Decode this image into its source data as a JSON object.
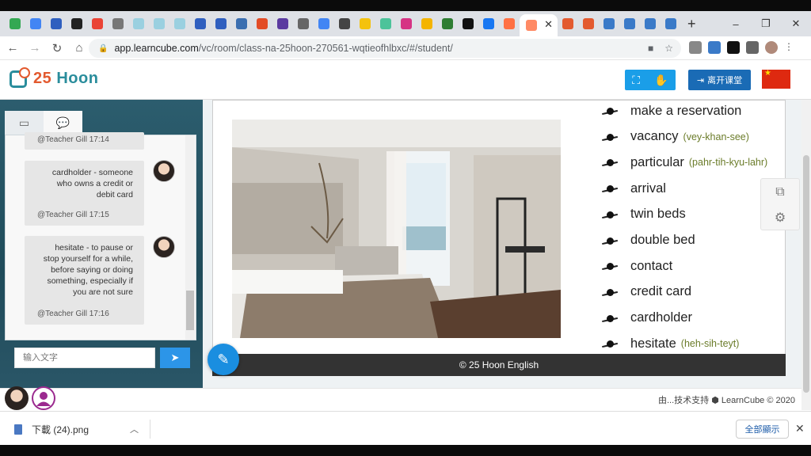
{
  "browser": {
    "url_host": "app.learncube.com",
    "url_path": "/vc/room/class-na-25hoon-270561-wqtieofhlbxc/#/student/",
    "tab_favicon_colors": [
      "#34a853",
      "#4285f4",
      "#2f5fbf",
      "#222222",
      "#ea4335",
      "#777777",
      "#9ad0e0",
      "#9ad0e0",
      "#9ad0e0",
      "#2f5fbf",
      "#2f5fbf",
      "#3b6fb0",
      "#e34c26",
      "#5b3aa0",
      "#666666",
      "#4285f4",
      "#444444",
      "#f4c20d",
      "#4cc39a",
      "#d63384",
      "#f4b400",
      "#2e7d32",
      "#111111",
      "#1877f2",
      "#ff7043",
      "#e35a2f",
      "#e35a2f",
      "#3a7ac8",
      "#3a7ac8",
      "#3a7ac8",
      "#3a7ac8"
    ],
    "new_tab_icon": "+",
    "window_controls": [
      "–",
      "❐",
      "✕"
    ]
  },
  "header": {
    "logo_number": "25",
    "logo_word": "Hoon",
    "leave_label": "离开课堂",
    "accent": "#1a9ee8",
    "flag_color": "#de2910"
  },
  "chat": {
    "top_stamp": "@Teacher Gill 17:14",
    "messages": [
      {
        "text": "cardholder - someone who owns a credit or debit card",
        "who": "@Teacher Gill 17:15"
      },
      {
        "text": "hesitate - to pause or stop yourself for a while, before saying or doing something, especially if you are not sure",
        "who": "@Teacher Gill 17:16"
      }
    ],
    "input_placeholder": "输入文字",
    "send_icon": "➤"
  },
  "slide": {
    "vocab": [
      {
        "word": "make a reservation",
        "pron": ""
      },
      {
        "word": "vacancy",
        "pron": "(vey-khan-see)"
      },
      {
        "word": "particular",
        "pron": "(pahr-tih-kyu-lahr)"
      },
      {
        "word": "arrival",
        "pron": ""
      },
      {
        "word": "twin beds",
        "pron": ""
      },
      {
        "word": "double bed",
        "pron": ""
      },
      {
        "word": "contact",
        "pron": ""
      },
      {
        "word": "credit card",
        "pron": ""
      },
      {
        "word": "cardholder",
        "pron": ""
      },
      {
        "word": "hesitate",
        "pron": "(heh-sih-teyt)"
      }
    ],
    "footer": "© 25 Hoon English"
  },
  "bottom": {
    "credit": "由...技术支持 ⬢ LearnCube © 2020"
  },
  "downloads": {
    "file_name": "下載 (24).png",
    "show_all": "全部顯示"
  }
}
